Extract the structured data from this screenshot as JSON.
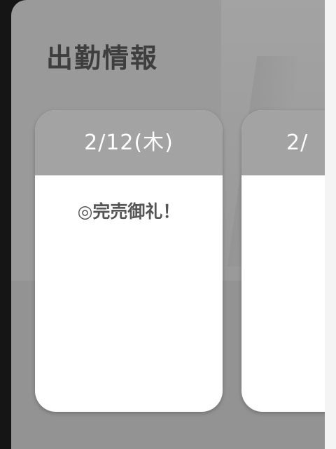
{
  "section": {
    "title": "出勤情報"
  },
  "schedule": {
    "cards": [
      {
        "date": "2/12(木)",
        "status": "◎完売御礼！"
      },
      {
        "date": "2/",
        "status": ""
      }
    ]
  }
}
